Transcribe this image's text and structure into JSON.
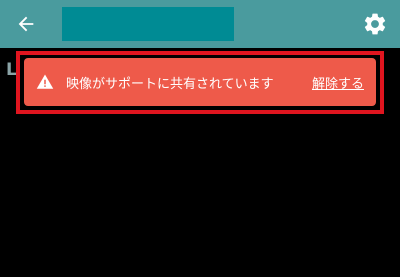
{
  "header": {
    "back_icon": "arrow-left-icon",
    "settings_icon": "gear-icon",
    "title_placeholder_color": "#008b94",
    "bar_color": "#4a9b9e"
  },
  "background_fragment": {
    "text": "L"
  },
  "banner": {
    "icon": "warning-icon",
    "message": "映像がサポートに共有されています",
    "action_label": "解除する",
    "color": "#ee5a4a",
    "highlight_color": "#e0151f"
  }
}
